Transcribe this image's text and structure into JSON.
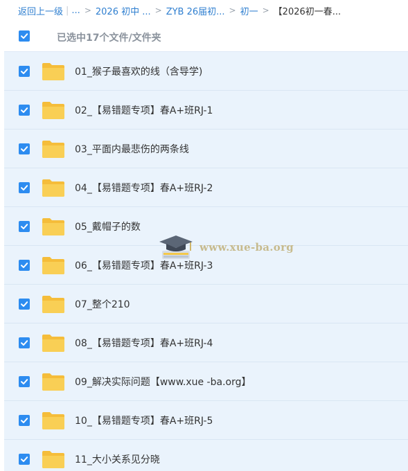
{
  "breadcrumb": {
    "back_label": "返回上一级",
    "ellipsis": "...",
    "items": [
      "2026 初中 ...",
      "ZYB 26届初...",
      "初一"
    ],
    "current": "【2026初一春..."
  },
  "selection": {
    "status": "已选中17个文件/文件夹",
    "checked": true
  },
  "files": [
    {
      "name": "01_猴子最喜欢的线（含导学)",
      "checked": true
    },
    {
      "name": "02_【易错题专项】春A+班RJ-1",
      "checked": true
    },
    {
      "name": "03_平面内最悲伤的两条线",
      "checked": true
    },
    {
      "name": "04_【易错题专项】春A+班RJ-2",
      "checked": true
    },
    {
      "name": "05_戴帽子的数",
      "checked": true
    },
    {
      "name": "06_【易错题专项】春A+班RJ-3",
      "checked": true
    },
    {
      "name": "07_整个210",
      "checked": true
    },
    {
      "name": "08_【易错题专项】春A+班RJ-4",
      "checked": true
    },
    {
      "name": "09_解决实际问题【www.xue -ba.org】",
      "checked": true
    },
    {
      "name": "10_【易错题专项】春A+班RJ-5",
      "checked": true
    },
    {
      "name": "11_大小关系见分晓",
      "checked": true
    }
  ],
  "watermark": {
    "text": "www.xue-ba.org"
  },
  "colors": {
    "accent": "#2d8cf0",
    "link": "#2f7fd0",
    "folder": "#f7c546",
    "row_bg": "#eaf3fc"
  },
  "icons": {
    "checkbox": "checkmark-icon",
    "folder": "folder-icon",
    "watermark": "graduation-cap-icon"
  }
}
